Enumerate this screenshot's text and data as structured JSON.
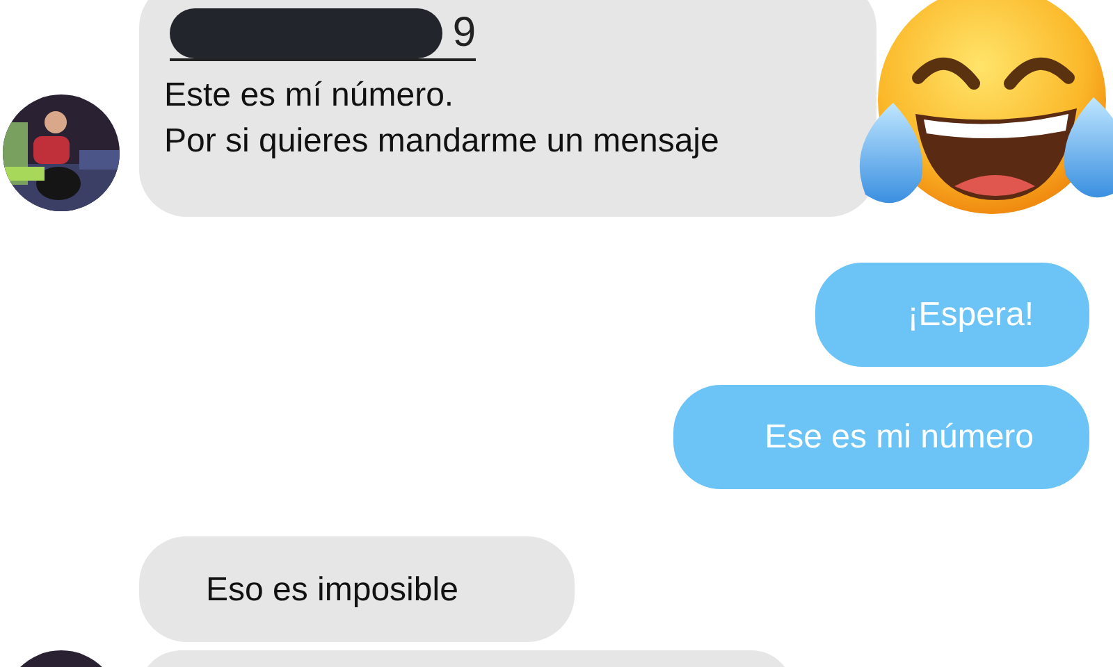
{
  "messages": [
    {
      "kind": "received",
      "avatar": true,
      "phone": "9",
      "redacted": true,
      "lines": [
        "Este es mí número.",
        "Por si quieres mandarme un mensaje"
      ]
    },
    {
      "kind": "sent",
      "lines": [
        "¡Espera!"
      ]
    },
    {
      "kind": "sent",
      "lines": [
        "Ese es mi número"
      ]
    },
    {
      "kind": "received",
      "avatar": false,
      "lines": [
        "Eso es imposible"
      ]
    },
    {
      "kind": "received",
      "avatar": true
    }
  ]
}
